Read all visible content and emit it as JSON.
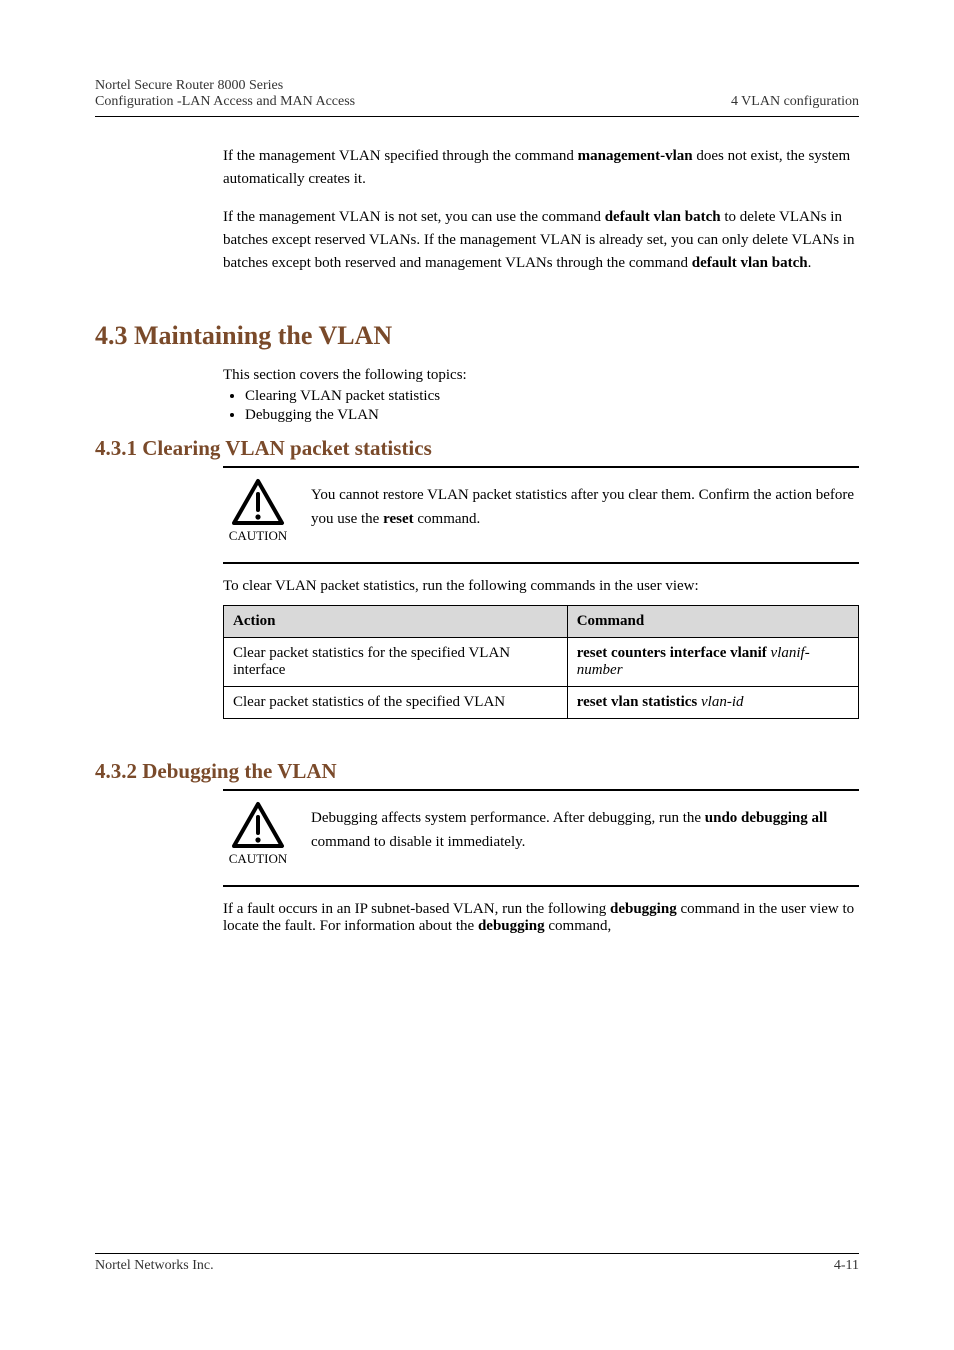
{
  "header": {
    "left_line1": "Nortel Secure Router 8000 Series",
    "left_line2": "Configuration -LAN Access and MAN Access",
    "right_line1": "4 VLAN configuration"
  },
  "intro": {
    "p1_prefix": "If the management VLAN specified through the command ",
    "p1_cmd": "management-vlan",
    "p1_suffix": " does not exist, the system automatically creates it.",
    "p2_prefix": "If the management VLAN is not set, you can use the command ",
    "p2_cmd": "default vlan batch",
    "p2_mid": " to delete VLANs in batches except reserved VLANs. If the management VLAN is already set, you can only delete VLANs in batches except both reserved and management VLANs through the command ",
    "p2_cmd2": "default vlan batch",
    "p2_suffix": "."
  },
  "section_4_3": {
    "title": "4.3 Maintaining the VLAN",
    "intro": "This section covers the following topics:",
    "bullets": [
      "Clearing VLAN packet statistics",
      "Debugging the VLAN"
    ]
  },
  "section_4_3_1": {
    "title": "4.3.1 Clearing VLAN packet statistics",
    "caution_label": "CAUTION",
    "caution_text_prefix": "You cannot restore VLAN packet statistics after you clear them. Confirm the action before you use the ",
    "caution_text_cmd": "reset",
    "caution_text_suffix": " command.",
    "lead_in": "To clear VLAN packet statistics, run the following commands in the user view:",
    "table": {
      "headers": [
        "Action",
        "Command"
      ],
      "rows": [
        {
          "action": "Clear packet statistics for the specified VLAN interface",
          "cmd_prefix": "reset counters interface vlanif",
          "cmd_arg": "vlanif-number"
        },
        {
          "action": "Clear packet statistics of the specified VLAN",
          "cmd_prefix": "reset vlan statistics",
          "cmd_arg": "vlan-id"
        }
      ]
    }
  },
  "section_4_3_2": {
    "title": "4.3.2 Debugging the VLAN",
    "caution_label": "CAUTION",
    "caution_text": "Debugging affects system performance. After debugging, run the ",
    "caution_cmd": "undo debugging all",
    "caution_suffix": " command to disable it immediately.",
    "tail_prefix": "If a fault occurs in an IP subnet-based VLAN, run the following ",
    "tail_cmd": "debugging",
    "tail_mid": " command in the user view to locate the fault. For information about the ",
    "tail_cmd2": "debugging",
    "tail_mid2": " command, "
  },
  "footer": {
    "left": "Nortel Networks Inc.",
    "right": "4-11"
  }
}
